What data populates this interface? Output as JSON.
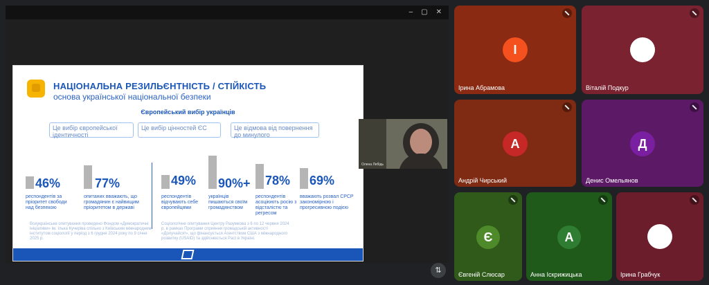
{
  "slide": {
    "title": "НАЦІОНАЛЬНА РЕЗИЛЬЄНТНІСТЬ / СТІЙКІСТЬ",
    "subtitle": "основа української національної безпеки",
    "section_title": "Європейський вибір українців",
    "pills": [
      "Це вибір європейської ідентичності",
      "Це вибір цінностей ЄС",
      "Це відмова від повернення до минулого"
    ],
    "stats": [
      {
        "value": "46%",
        "label": "респондентів за пріоритет свободи над безпекою"
      },
      {
        "value": "77%",
        "label": "опитаних вважають, що громадянин є найвищим пріоритетом в державі"
      },
      {
        "value": "49%",
        "label": "респондентів відчувають себе європейцями"
      },
      {
        "value": "90%+",
        "label": "українців пишаються своїм громадянством"
      },
      {
        "value": "78%",
        "label": "респондентів асоціюють росію з відсталістю та регресом"
      },
      {
        "value": "69%",
        "label": "вважають розвал СРСР закономірною і прогресивною подією"
      }
    ],
    "notes": [
      "Всеукраїнське опитування проведено Фондом «Демократичні ініціативи» ім. Ілька Кучеріва спільно з Київським міжнародним інститутом соціології у період з 6 грудня 2024 року по 9 січня 2025 р.",
      "Соціологічне опитування Центру Разумкова з 6 по 12 червня 2024 р. в рамках Програми сприяння громадській активності «Долучайся!», що фінансується Агентством США з міжнародного розвитку (USAID) та здійснюється Pact в Україні."
    ]
  },
  "presenter": {
    "name": "Олена Лебідь"
  },
  "bottom_button_icon": "swap-icon",
  "participants": [
    {
      "name": "Ірина Абрамова",
      "initial": "І",
      "tile_color": "#8a2a12",
      "avatar_color": "#f4511e",
      "muted": true
    },
    {
      "name": "Віталій Подкур",
      "initial": "",
      "tile_color": "#7a2230",
      "avatar_color": "#ffffff",
      "muted": true,
      "photo": true
    },
    {
      "name": "Андрій Чирський",
      "initial": "А",
      "tile_color": "#7f2a12",
      "avatar_color": "#c62828",
      "muted": true
    },
    {
      "name": "Денис Омельянов",
      "initial": "Д",
      "tile_color": "#5c1a66",
      "avatar_color": "#7b1fa2",
      "muted": true
    },
    {
      "name": "Євгеній Слюсар",
      "initial": "Є",
      "tile_color": "#2f5a1a",
      "avatar_color": "#4e8a2a",
      "muted": true
    },
    {
      "name": "Анна Іскрижицька",
      "initial": "А",
      "tile_color": "#1f5a1a",
      "avatar_color": "#2e7d32",
      "muted": true
    },
    {
      "name": "Ірина Грабчук",
      "initial": "",
      "tile_color": "#6b1d2b",
      "avatar_color": "#ffffff",
      "muted": true,
      "photo": true
    }
  ]
}
